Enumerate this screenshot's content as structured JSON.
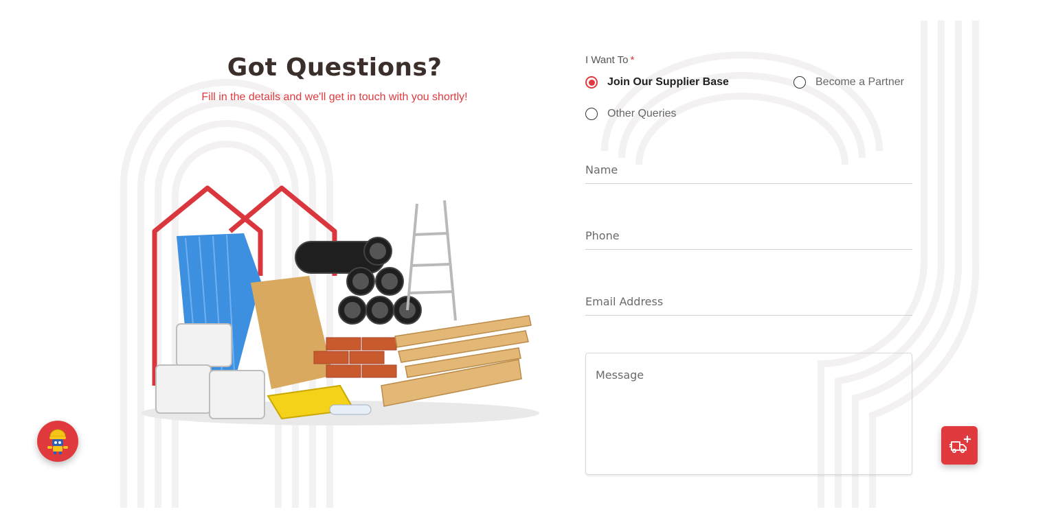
{
  "header": {
    "title": "Got Questions?",
    "subtitle": "Fill in the details and we'll get in touch with you shortly!"
  },
  "form": {
    "intent_label": "I Want To",
    "required_marker": "*",
    "options": [
      {
        "label": "Join Our Supplier Base",
        "selected": true
      },
      {
        "label": "Become a Partner",
        "selected": false
      },
      {
        "label": "Other Queries",
        "selected": false
      }
    ],
    "name": {
      "placeholder": "Name",
      "value": ""
    },
    "phone": {
      "placeholder": "Phone",
      "value": ""
    },
    "email": {
      "placeholder": "Email Address",
      "value": ""
    },
    "message": {
      "placeholder": "Message",
      "value": ""
    }
  },
  "icons": {
    "hero": "construction-materials-illustration",
    "left_fab": "robot-assistant-icon",
    "right_fab": "delivery-truck-add-icon"
  },
  "colors": {
    "accent": "#e0393e",
    "heading": "#3a2f2b",
    "background": "#ffffff"
  }
}
